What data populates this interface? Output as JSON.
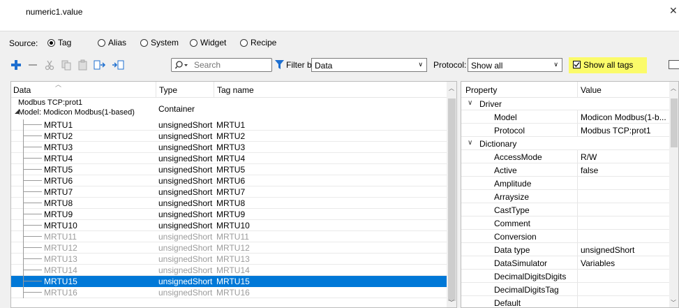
{
  "window": {
    "title": "numeric1.value"
  },
  "source": {
    "label": "Source:",
    "options": [
      {
        "label": "Tag",
        "checked": true
      },
      {
        "label": "Alias",
        "checked": false
      },
      {
        "label": "System",
        "checked": false
      },
      {
        "label": "Widget",
        "checked": false
      },
      {
        "label": "Recipe",
        "checked": false
      }
    ]
  },
  "toolbar": {
    "icons": [
      "add-icon",
      "remove-icon",
      "cut-icon",
      "copy-icon",
      "paste-icon",
      "import-icon",
      "export-icon"
    ],
    "search_placeholder": "Search",
    "filter_label": "Filter by:",
    "filter_value": "Data",
    "protocol_label": "Protocol:",
    "protocol_value": "Show all",
    "show_all_tags_label": "Show all tags",
    "show_all_tags_checked": true,
    "highlight_color": "#fbfb6a"
  },
  "grid": {
    "columns": [
      "Data",
      "Type",
      "Tag name"
    ],
    "container": {
      "line1": "Modbus TCP:prot1",
      "line2": "Model: Modicon Modbus(1-based)",
      "type": "Container"
    },
    "rows": [
      {
        "data": "MRTU1",
        "type": "unsignedShort",
        "tag": "MRTU1",
        "state": "normal"
      },
      {
        "data": "MRTU2",
        "type": "unsignedShort",
        "tag": "MRTU2",
        "state": "normal"
      },
      {
        "data": "MRTU3",
        "type": "unsignedShort",
        "tag": "MRTU3",
        "state": "normal"
      },
      {
        "data": "MRTU4",
        "type": "unsignedShort",
        "tag": "MRTU4",
        "state": "normal"
      },
      {
        "data": "MRTU5",
        "type": "unsignedShort",
        "tag": "MRTU5",
        "state": "normal"
      },
      {
        "data": "MRTU6",
        "type": "unsignedShort",
        "tag": "MRTU6",
        "state": "normal"
      },
      {
        "data": "MRTU7",
        "type": "unsignedShort",
        "tag": "MRTU7",
        "state": "normal"
      },
      {
        "data": "MRTU8",
        "type": "unsignedShort",
        "tag": "MRTU8",
        "state": "normal"
      },
      {
        "data": "MRTU9",
        "type": "unsignedShort",
        "tag": "MRTU9",
        "state": "normal"
      },
      {
        "data": "MRTU10",
        "type": "unsignedShort",
        "tag": "MRTU10",
        "state": "normal"
      },
      {
        "data": "MRTU11",
        "type": "unsignedShort",
        "tag": "MRTU11",
        "state": "inactive"
      },
      {
        "data": "MRTU12",
        "type": "unsignedShort",
        "tag": "MRTU12",
        "state": "inactive"
      },
      {
        "data": "MRTU13",
        "type": "unsignedShort",
        "tag": "MRTU13",
        "state": "inactive"
      },
      {
        "data": "MRTU14",
        "type": "unsignedShort",
        "tag": "MRTU14",
        "state": "inactive"
      },
      {
        "data": "MRTU15",
        "type": "unsignedShort",
        "tag": "MRTU15",
        "state": "selected"
      },
      {
        "data": "MRTU16",
        "type": "unsignedShort",
        "tag": "MRTU16",
        "state": "inactive"
      }
    ],
    "selection_color": "#0078d7"
  },
  "properties": {
    "columns": [
      "Property",
      "Value"
    ],
    "items": [
      {
        "kind": "category",
        "name": "Driver"
      },
      {
        "kind": "prop",
        "name": "Model",
        "value": "Modicon Modbus(1-b..."
      },
      {
        "kind": "prop",
        "name": "Protocol",
        "value": "Modbus TCP:prot1"
      },
      {
        "kind": "category",
        "name": "Dictionary"
      },
      {
        "kind": "prop",
        "name": "AccessMode",
        "value": "R/W"
      },
      {
        "kind": "prop",
        "name": "Active",
        "value": "false"
      },
      {
        "kind": "prop",
        "name": "Amplitude",
        "value": ""
      },
      {
        "kind": "prop",
        "name": "Arraysize",
        "value": ""
      },
      {
        "kind": "prop",
        "name": "CastType",
        "value": ""
      },
      {
        "kind": "prop",
        "name": "Comment",
        "value": ""
      },
      {
        "kind": "prop",
        "name": "Conversion",
        "value": ""
      },
      {
        "kind": "prop",
        "name": "Data type",
        "value": "unsignedShort"
      },
      {
        "kind": "prop",
        "name": "DataSimulator",
        "value": "Variables"
      },
      {
        "kind": "prop",
        "name": "DecimalDigitsDigits",
        "value": ""
      },
      {
        "kind": "prop",
        "name": "DecimalDigitsTag",
        "value": ""
      },
      {
        "kind": "prop",
        "name": "Default",
        "value": ""
      }
    ]
  }
}
